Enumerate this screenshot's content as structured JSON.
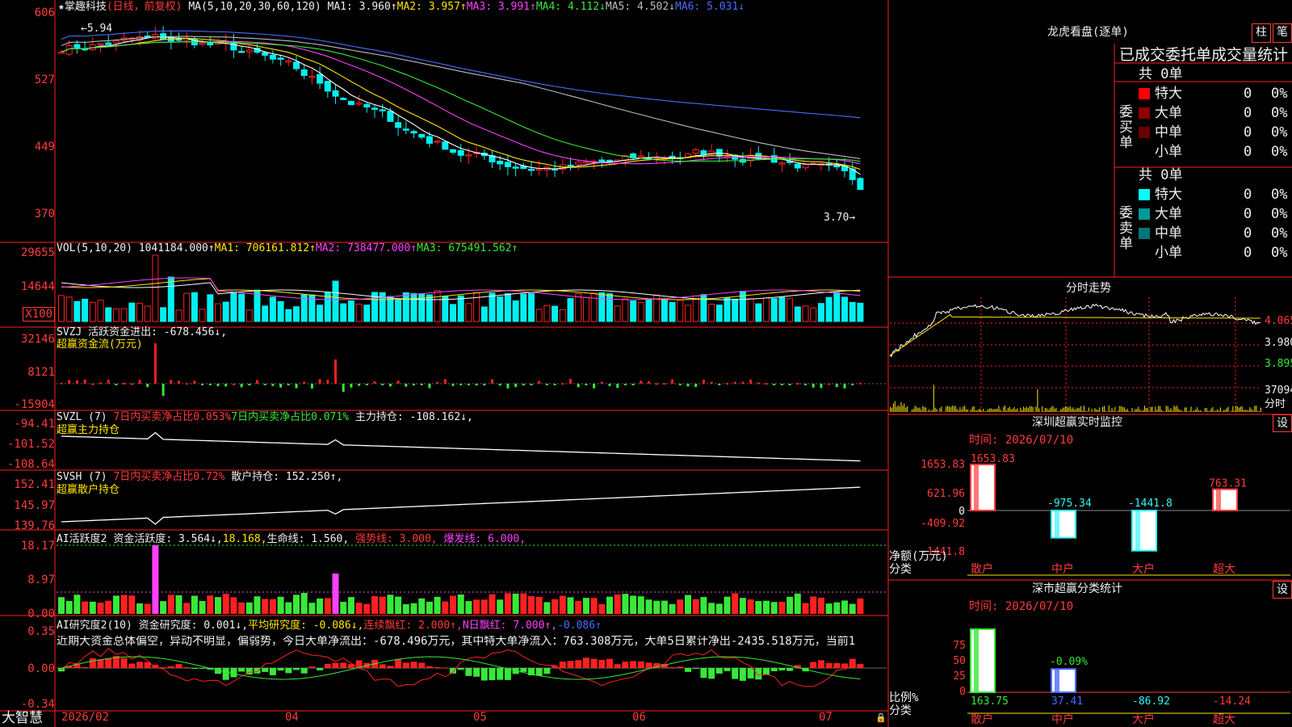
{
  "header": {
    "star": "★",
    "stock": "掌趣科技",
    "mode": "(日线，前复权)",
    "ma_label": "MA(5,10,20,30,60,120)",
    "ma1": "MA1: 3.960↑",
    "ma2": "MA2: 3.957↑",
    "ma3": "MA3: 3.991↑",
    "ma4": "MA4: 4.112↓",
    "ma5": "MA5: 4.502↓",
    "ma6": "MA6: 5.031↓"
  },
  "price_axis": [
    "606",
    "527",
    "449",
    "370"
  ],
  "price_annot": {
    "high": "5.94",
    "low": "3.70→"
  },
  "vol": {
    "title": "VOL(5,10,20)",
    "value": "1041184.000↑",
    "ma1": "MA1: 706161.812↑",
    "ma2": "MA2: 738477.000↑",
    "ma3": "MA3: 675491.562↑",
    "axis": [
      "29655",
      "14644",
      "X100"
    ]
  },
  "svzj": {
    "title": "SVZJ",
    "desc": "活跃资金进出: -678.456↓,",
    "sub": "超赢资金流(万元)",
    "axis": [
      "32146",
      "8121",
      "-15904"
    ]
  },
  "svzl": {
    "title": "SVZL (7)",
    "a": "7日内买卖净占比0.053%",
    "b": "7日内买卖净占比0.071%",
    "c": "主力持仓: -108.162↓,",
    "sub": "超赢主力持仓",
    "axis": [
      "-94.41",
      "-101.52",
      "-108.64"
    ]
  },
  "svsh": {
    "title": "SVSH (7)",
    "a": "7日内买卖净占比0.72%",
    "c": "散户持仓: 152.250↑,",
    "sub": "超赢散户持仓",
    "axis": [
      "152.41",
      "145.97",
      "139.76"
    ]
  },
  "ai1": {
    "title": "AI活跃度2",
    "a": "资金活跃度: 3.564↓,",
    "b": "18.168,",
    "c": "生命线: 1.560,",
    "d": "强势线: 3.000,",
    "e": "爆发线: 6.000,",
    "axis": [
      "18.17",
      "8.97",
      "0.00"
    ]
  },
  "ai2": {
    "title": "AI研究度2(10)",
    "a": "资金研究度: 0.001↓,",
    "b": "平均研究度: -0.086↓,",
    "c": "连续飘红: 2.000↑,",
    "d": "N日飘红: 7.000↑,",
    "e": "-0.086↑",
    "text": "近期大资金总体偏空，异动不明显，偏弱势，今日大单净流出：-678.496万元，其中特大单净流入：763.308万元，大单5日累计净出-2435.518万元，当前1",
    "axis": [
      "0.35",
      "0.00",
      "-0.34"
    ]
  },
  "date_axis": {
    "brand": "大智慧",
    "labels": [
      "2026/02",
      "04",
      "05",
      "06",
      "07"
    ]
  },
  "lhb": {
    "title": "龙虎看盘(逐单)",
    "btn1": "柱",
    "btn2": "笔",
    "subtitle": "已成交委托单成交量统计",
    "buy_label": "委买单",
    "sell_label": "委卖单",
    "buy_total": "共 0单",
    "sell_total": "共 0单",
    "buy_rows": [
      {
        "name": "特大",
        "count": "0",
        "pct": "0%",
        "color": "#ff0000"
      },
      {
        "name": "大单",
        "count": "0",
        "pct": "0%",
        "color": "#8b0000"
      },
      {
        "name": "中单",
        "count": "0",
        "pct": "0%",
        "color": "#6a0000"
      },
      {
        "name": "小单",
        "count": "0",
        "pct": "0%",
        "color": ""
      }
    ],
    "sell_rows": [
      {
        "name": "特大",
        "count": "0",
        "pct": "0%",
        "color": "#00ffff"
      },
      {
        "name": "大单",
        "count": "0",
        "pct": "0%",
        "color": "#009999"
      },
      {
        "name": "中单",
        "count": "0",
        "pct": "0%",
        "color": "#007777"
      },
      {
        "name": "小单",
        "count": "0",
        "pct": "0%",
        "color": ""
      }
    ]
  },
  "fenshi": {
    "title": "分时走势",
    "axis": [
      "4.065",
      "3.980",
      "3.895",
      "37094",
      "分时"
    ]
  },
  "sz_monitor": {
    "title": "深圳超赢实时监控",
    "btn": "设",
    "time": "时间: 2026/07/10",
    "axis": [
      "1653.83",
      "621.96",
      "0",
      "-409.92",
      "-1441.8"
    ],
    "ylabel": "净额(万元)",
    "xlabel": "分类",
    "categories": [
      "散户",
      "中户",
      "大户",
      "超大"
    ],
    "values": [
      1653.83,
      -975.34,
      -1441.8,
      763.31
    ],
    "value_labels": [
      "1653.83",
      "-975.34",
      "-1441.8",
      "763.31"
    ],
    "colors": [
      "#ff3b3b",
      "#33f6f6",
      "#33f6f6",
      "#ff3b3b"
    ]
  },
  "sz_stats": {
    "title": "深市超赢分类统计",
    "btn": "设",
    "time": "时间: 2026/07/10",
    "axis": [
      "75",
      "50",
      "25",
      "0"
    ],
    "ylabel": "比例%",
    "xlabel": "分类",
    "categories": [
      "散户",
      "中户",
      "大户",
      "超大"
    ],
    "values": [
      163.75,
      37.41,
      -86.92,
      -14.24
    ],
    "value_labels": [
      "163.75",
      "37.41",
      "-86.92",
      "-14.24"
    ],
    "mid_label": "-0.09%",
    "colors": [
      "#38e838",
      "#4a6cff",
      "#33f6f6",
      "#ff3b3b"
    ]
  }
}
